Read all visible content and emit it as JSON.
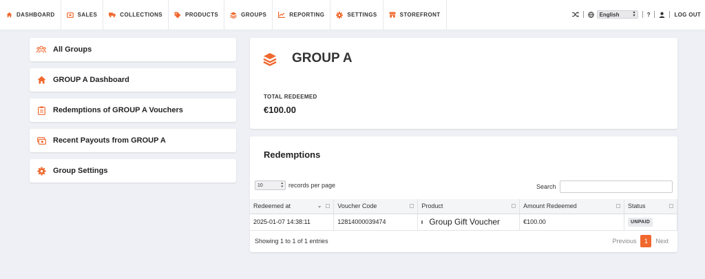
{
  "nav": {
    "items": [
      {
        "label": "DASHBOARD",
        "icon": "home-icon"
      },
      {
        "label": "SALES",
        "icon": "ticket-icon"
      },
      {
        "label": "COLLECTIONS",
        "icon": "truck-icon"
      },
      {
        "label": "PRODUCTS",
        "icon": "tag-icon"
      },
      {
        "label": "GROUPS",
        "icon": "layers-icon"
      },
      {
        "label": "REPORTING",
        "icon": "chart-icon"
      },
      {
        "label": "SETTINGS",
        "icon": "gear-icon"
      },
      {
        "label": "STOREFRONT",
        "icon": "store-icon"
      }
    ],
    "language": "English",
    "help": "?",
    "logout": "LOG OUT"
  },
  "sidebar": {
    "items": [
      {
        "label": "All Groups",
        "icon": "users-icon"
      },
      {
        "label": "GROUP A Dashboard",
        "icon": "home-icon"
      },
      {
        "label": "Redemptions of GROUP A Vouchers",
        "icon": "clipboard-icon"
      },
      {
        "label": "Recent Payouts from GROUP A",
        "icon": "money-icon"
      },
      {
        "label": "Group Settings",
        "icon": "gear-icon"
      }
    ]
  },
  "group": {
    "title": "GROUP A",
    "total_label": "TOTAL REDEEMED",
    "total_value": "€100.00"
  },
  "redemptions": {
    "title": "Redemptions",
    "per_page": "10",
    "per_page_label": "records per page",
    "search_label": "Search",
    "search_value": "",
    "columns": [
      "Redeemed at",
      "Voucher Code",
      "Product",
      "Amount Redeemed",
      "Status"
    ],
    "rows": [
      {
        "redeemed_at": "2025-01-07 14:38:11",
        "voucher_code": "12814000039474",
        "product": "Group Gift Voucher",
        "amount": "€100.00",
        "status": "UNPAID"
      }
    ],
    "info": "Showing 1 to 1 of 1 entries",
    "prev": "Previous",
    "page": "1",
    "next": "Next"
  },
  "colors": {
    "accent": "#f0682e",
    "background": "#eef0f5"
  }
}
